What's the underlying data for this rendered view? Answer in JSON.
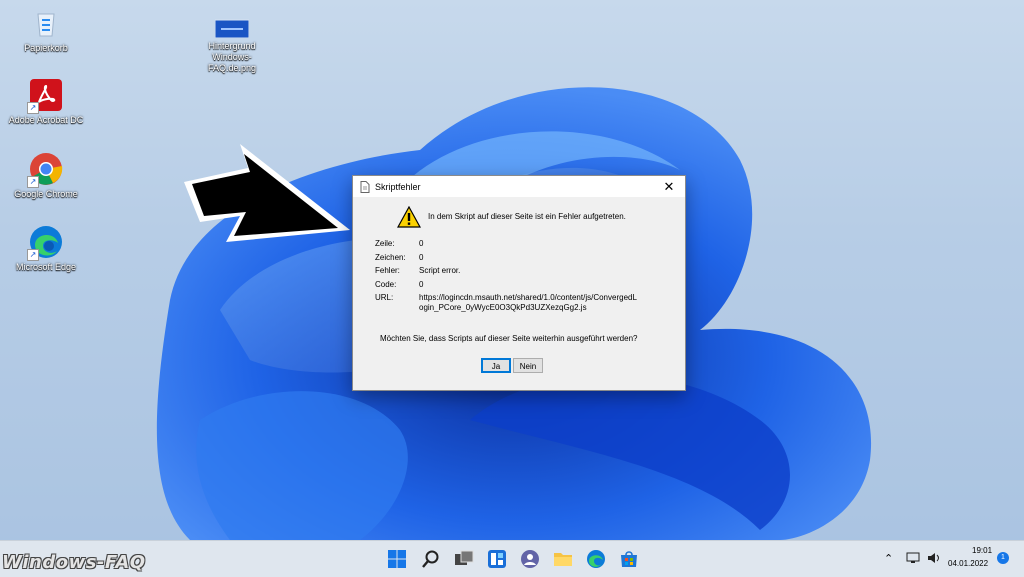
{
  "desktop": {
    "icons": [
      {
        "label": "Papierkorb",
        "icon": "recycle-bin-icon"
      },
      {
        "label": "Hintergrund Windows-FAQ.de.png",
        "icon": "image-file-icon"
      },
      {
        "label": "Adobe Acrobat DC",
        "icon": "adobe-acrobat-icon"
      },
      {
        "label": "Google Chrome",
        "icon": "chrome-icon"
      },
      {
        "label": "Microsoft Edge",
        "icon": "edge-icon"
      }
    ]
  },
  "dialog": {
    "title": "Skriptfehler",
    "close_glyph": "✕",
    "message": "In dem Skript auf dieser Seite ist ein Fehler aufgetreten.",
    "fields": [
      {
        "key": "Zeile:",
        "value": "0"
      },
      {
        "key": "Zeichen:",
        "value": "0"
      },
      {
        "key": "Fehler:",
        "value": "Script error."
      },
      {
        "key": "Code:",
        "value": "0"
      },
      {
        "key": "URL:",
        "value": "https://logincdn.msauth.net/shared/1.0/content/js/ConvergedLogin_PCore_0yWycE0O3QkPd3UZXezqGg2.js"
      }
    ],
    "question": "Möchten Sie, dass Scripts auf dieser Seite weiterhin ausgeführt werden?",
    "buttons": {
      "yes": "Ja",
      "no": "Nein"
    }
  },
  "taskbar": {
    "apps": [
      "start-icon",
      "search-icon",
      "task-view-icon",
      "widgets-icon",
      "teams-chat-icon",
      "file-explorer-icon",
      "edge-icon",
      "store-icon"
    ],
    "tray": {
      "time": "19:01",
      "date": "04.01.2022",
      "notification_count": "1"
    }
  },
  "watermark": "Windows-FAQ",
  "colors": {
    "accent": "#0078d7",
    "wallpaper_blue": "#1f63e6"
  }
}
